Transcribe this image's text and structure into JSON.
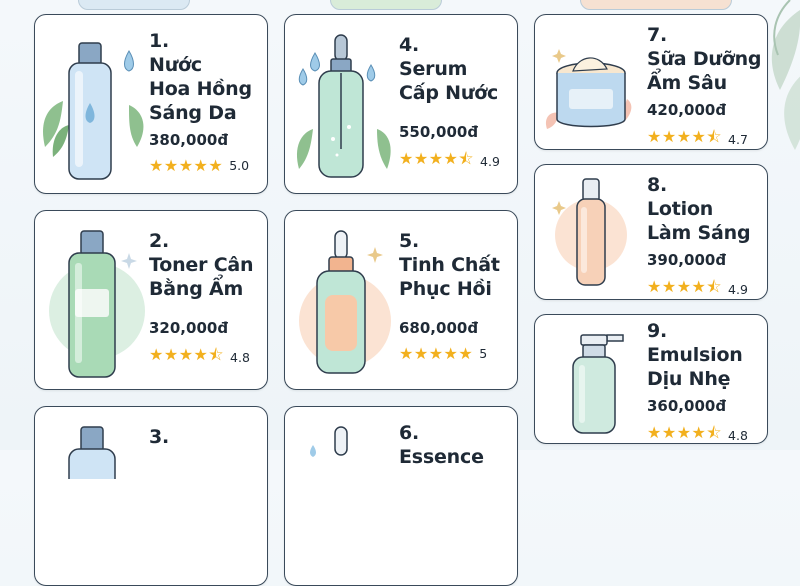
{
  "products": [
    {
      "number": "1.",
      "name": "Nước\nHoa Hồng\nSáng Da",
      "price": "380,000đ",
      "stars": "★★★★★",
      "rating": "5.0",
      "icon": "toner-bottle-icon"
    },
    {
      "number": "2.",
      "name": "Toner Cân\nBằng Ẩm",
      "price": "320,000đ",
      "stars": "★★★★⯪",
      "rating": "4.8",
      "icon": "toner-bottle-icon"
    },
    {
      "number": "3.",
      "icon": "toner-bottle-icon"
    },
    {
      "number": "4.",
      "name": "Serum\nCấp Nước",
      "price": "550,000đ",
      "stars": "★★★★⯪",
      "rating": "4.9",
      "icon": "dropper-bottle-icon"
    },
    {
      "number": "5.",
      "name": "Tinh Chất\nPhục Hồi",
      "price": "680,000đ",
      "stars": "★★★★★",
      "rating": "5",
      "icon": "dropper-bottle-icon"
    },
    {
      "number": "6.",
      "name": "Essence",
      "icon": "dropper-bottle-icon"
    },
    {
      "number": "7.",
      "name": "Sữa Dưỡng\nẨm Sâu",
      "price": "420,000đ",
      "stars": "★★★★⯪",
      "rating": "4.7",
      "icon": "cream-jar-icon"
    },
    {
      "number": "8.",
      "name": "Lotion\nLàm Sáng",
      "price": "390,000đ",
      "stars": "★★★★⯪",
      "rating": "4.9",
      "icon": "pump-bottle-icon"
    },
    {
      "number": "9.",
      "name": "Emulsion\nDịu Nhẹ",
      "price": "360,000đ",
      "stars": "★★★★⯪",
      "rating": "4.8",
      "icon": "pump-bottle-icon"
    }
  ]
}
